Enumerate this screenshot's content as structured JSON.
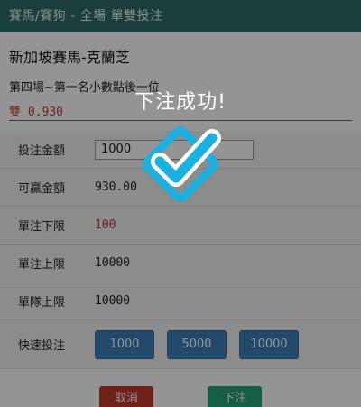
{
  "header": {
    "title": "賽馬/賽狗 - 全場 單雙投注"
  },
  "info": {
    "race_title": "新加坡賽馬-克蘭芝",
    "race_subtitle": "第四場~第一名小數點後一位",
    "odds_label": "雙",
    "odds_value": "0.930"
  },
  "form": {
    "amount_label": "投注金額",
    "amount_value": "1000",
    "win_label": "可贏金額",
    "win_value": "930.00",
    "min_label": "單注下限",
    "min_value": "100",
    "max_label": "單注上限",
    "max_value": "10000",
    "team_max_label": "單隊上限",
    "team_max_value": "10000",
    "quick_label": "快速投注",
    "quick_options": [
      "1000",
      "5000",
      "10000"
    ]
  },
  "footer": {
    "cancel_label": "取消",
    "submit_label": "下注"
  },
  "toast": {
    "message": "下注成功!",
    "icon": "check-badge-icon"
  },
  "colors": {
    "header": "#2e6b63",
    "odds": "#c0392b",
    "quick_button": "#3f80b8",
    "cancel": "#c0392b",
    "submit": "#26a17a",
    "check_icon": "#1ab0e0"
  }
}
